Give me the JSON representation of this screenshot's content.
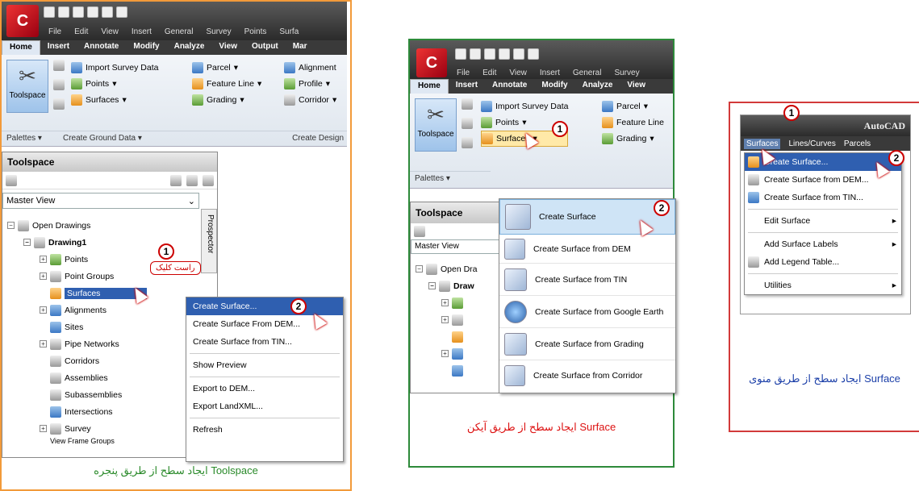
{
  "left": {
    "menubar": [
      "File",
      "Edit",
      "View",
      "Insert",
      "General",
      "Survey",
      "Points",
      "Surfa"
    ],
    "tabs": [
      "Home",
      "Insert",
      "Annotate",
      "Modify",
      "Analyze",
      "View",
      "Output",
      "Mar"
    ],
    "ribbon": {
      "toolspace": "Toolspace",
      "import_survey": "Import Survey Data",
      "points": "Points",
      "surfaces": "Surfaces",
      "parcel": "Parcel",
      "feature_line": "Feature Line",
      "grading": "Grading",
      "alignment": "Alignment",
      "profile": "Profile",
      "corridor": "Corridor",
      "palettes": "Palettes",
      "create_ground": "Create Ground Data",
      "create_design": "Create Design"
    },
    "toolspace_title": "Toolspace",
    "master_view": "Master View",
    "prospector": "Prospector",
    "tree": {
      "open_drawings": "Open Drawings",
      "drawing": "Drawing1",
      "items": [
        "Points",
        "Point Groups",
        "Surfaces",
        "Alignments",
        "Sites",
        "Pipe Networks",
        "Corridors",
        "Assemblies",
        "Subassemblies",
        "Intersections",
        "Survey",
        "View Frame Groups"
      ]
    },
    "rightclick_label": "راست کلیک",
    "context_menu": [
      "Create Surface...",
      "Create Surface From DEM...",
      "Create Surface from TIN...",
      "Show Preview",
      "Export to DEM...",
      "Export LandXML...",
      "Refresh"
    ],
    "caption": "ایجاد سطح از طریق پنجره Toolspace",
    "badge1": "1",
    "badge2": "2"
  },
  "middle": {
    "menubar": [
      "File",
      "Edit",
      "View",
      "Insert",
      "General",
      "Survey"
    ],
    "tabs": [
      "Home",
      "Insert",
      "Annotate",
      "Modify",
      "Analyze",
      "View"
    ],
    "ribbon": {
      "toolspace": "Toolspace",
      "import_survey": "Import Survey Data",
      "points": "Points",
      "surfaces": "Surfaces",
      "parcel": "Parcel",
      "feature_line": "Feature Line",
      "grading": "Grading",
      "palettes": "Palettes"
    },
    "toolspace_title": "Toolspace",
    "master_view": "Master View",
    "tree": {
      "open_drawings": "Open Dra",
      "drawing": "Draw"
    },
    "dropdown": [
      "Create Surface",
      "Create Surface from DEM",
      "Create Surface from TIN",
      "Create Surface from Google Earth",
      "Create Surface from Grading",
      "Create Surface from Corridor"
    ],
    "caption": "ایجاد سطح از طریق آیکن Surface",
    "badge1": "1",
    "badge2": "2"
  },
  "right": {
    "title": "AutoCAD",
    "menubar": [
      "Surfaces",
      "Lines/Curves",
      "Parcels"
    ],
    "menu": [
      "Create Surface...",
      "Create Surface from DEM...",
      "Create Surface from TIN...",
      "Edit Surface",
      "Add Surface Labels",
      "Add Legend Table...",
      "Utilities"
    ],
    "caption": "ایجاد سطح از طریق منوی Surface",
    "badge1": "1",
    "badge2": "2"
  },
  "colors": {
    "left_border": "#f29a3a",
    "middle_border": "#2d8a3a",
    "right_border": "#d23a3a",
    "highlight": "#2f5fb0",
    "caption_green": "#2a8a2a",
    "caption_red": "#d11",
    "caption_blue": "#1b3fa8"
  }
}
